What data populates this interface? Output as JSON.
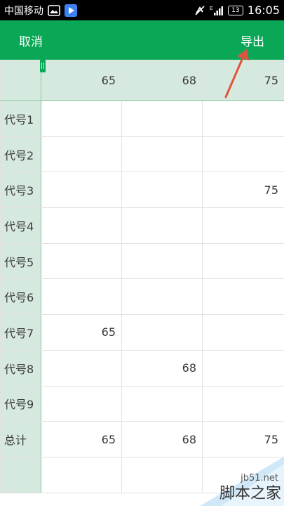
{
  "status_bar": {
    "carrier": "中国移动",
    "time": "16:05",
    "battery": "13",
    "network": "E"
  },
  "app_bar": {
    "cancel_label": "取消",
    "export_label": "导出"
  },
  "grid": {
    "column_headers": [
      "65",
      "68",
      "75"
    ],
    "rows": [
      {
        "label": "代号1",
        "cells": [
          "",
          "",
          ""
        ]
      },
      {
        "label": "代号2",
        "cells": [
          "",
          "",
          ""
        ]
      },
      {
        "label": "代号3",
        "cells": [
          "",
          "",
          "75"
        ]
      },
      {
        "label": "代号4",
        "cells": [
          "",
          "",
          ""
        ]
      },
      {
        "label": "代号5",
        "cells": [
          "",
          "",
          ""
        ]
      },
      {
        "label": "代号6",
        "cells": [
          "",
          "",
          ""
        ]
      },
      {
        "label": "代号7",
        "cells": [
          "65",
          "",
          ""
        ]
      },
      {
        "label": "代号8",
        "cells": [
          "",
          "68",
          ""
        ]
      },
      {
        "label": "代号9",
        "cells": [
          "",
          "",
          ""
        ]
      },
      {
        "label": "总计",
        "cells": [
          "65",
          "68",
          "75"
        ]
      },
      {
        "label": "",
        "cells": [
          "",
          "",
          ""
        ]
      }
    ]
  },
  "watermark": {
    "site": "jb51.net",
    "brand": "脚本之家"
  },
  "colors": {
    "accent": "#0aa856",
    "header_bg": "#d6e9de",
    "arrow": "#e0533f"
  }
}
